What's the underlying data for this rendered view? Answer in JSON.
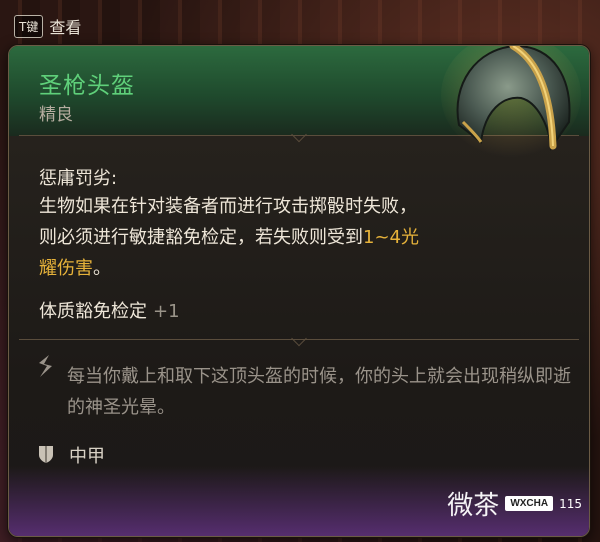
{
  "hint": {
    "key": "T键",
    "label": "查看"
  },
  "item": {
    "name": "圣枪头盔",
    "rarity": "精良",
    "ability_title": "惩庸罚劣:",
    "desc_pre": "生物如果在针对装备者而进行攻击掷骰时失败，则必须进行敏捷豁免检定，若失败则受到",
    "desc_highlight": "1~4光耀伤害",
    "desc_post": "。",
    "stat_label": "体质豁免检定",
    "stat_value": "+1",
    "flavor": "每当你戴上和取下这顶头盔的时候，你的头上就会出现稍纵即逝的神圣光晕。",
    "armor_type": "中甲"
  },
  "watermark": {
    "text": "微茶",
    "badge": "WXCHA",
    "sub": "115"
  },
  "colors": {
    "name": "#5fd07a",
    "highlight": "#e6b23a",
    "header": "#2c6a3e",
    "footer": "#5c3078"
  },
  "icons": {
    "flavor": "quill-icon",
    "armor": "shield-icon",
    "item": "helmet-icon"
  }
}
